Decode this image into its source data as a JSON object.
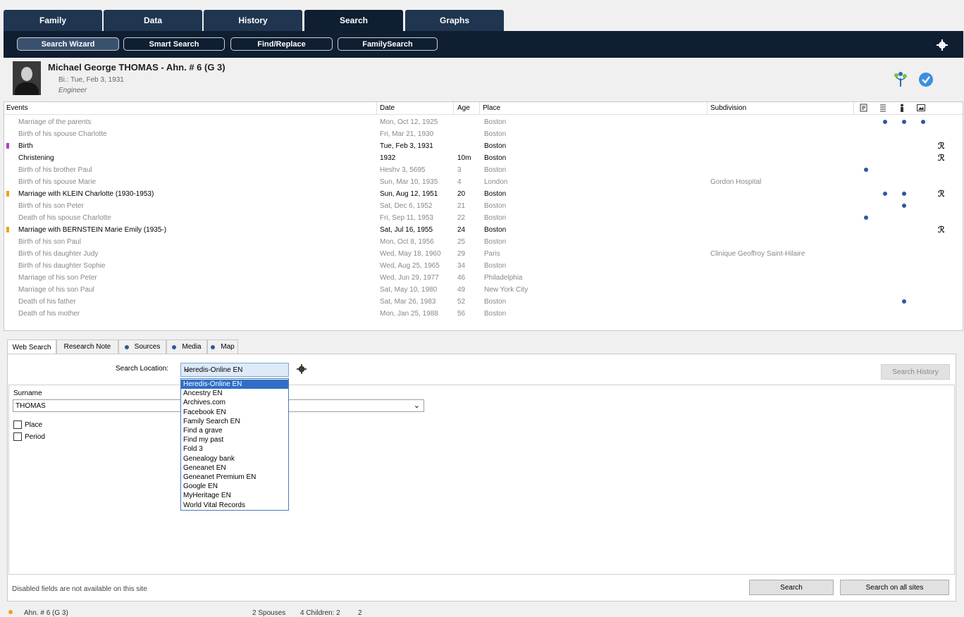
{
  "main_tabs": [
    "Family",
    "Data",
    "History",
    "Search",
    "Graphs"
  ],
  "active_main_tab": "Search",
  "sub_buttons": [
    "Search Wizard",
    "Smart Search",
    "Find/Replace",
    "FamilySearch"
  ],
  "active_sub_button": "Search Wizard",
  "person": {
    "name": "Michael George THOMAS - Ahn. # 6 (G 3)",
    "birth": "Bi.: Tue, Feb 3, 1931",
    "occupation": "Engineer"
  },
  "events_table": {
    "headers": {
      "event": "Events",
      "date": "Date",
      "age": "Age",
      "place": "Place",
      "subdivision": "Subdivision"
    },
    "rows": [
      {
        "event": "Marriage of the parents",
        "date": "Mon, Oct 12, 1925",
        "age": "",
        "place": "Boston",
        "subdivision": "",
        "style": "grey",
        "dots": [
          1,
          2,
          3
        ]
      },
      {
        "event": "Birth of his spouse Charlotte",
        "date": "Fri, Mar 21, 1930",
        "age": "",
        "place": "Boston",
        "subdivision": "",
        "style": "grey",
        "dots": []
      },
      {
        "event": "Birth",
        "date": "Tue, Feb 3, 1931",
        "age": "",
        "place": "Boston",
        "subdivision": "",
        "style": "main",
        "marker": "#b040c0",
        "dots": [],
        "fx": "R̷"
      },
      {
        "event": "Christening",
        "date": "1932",
        "age": "10m",
        "place": "Boston",
        "subdivision": "",
        "style": "main",
        "dots": [],
        "fx": "R"
      },
      {
        "event": "Birth of his brother Paul",
        "date": "Heshv 3, 5695",
        "age": "3",
        "place": "Boston",
        "subdivision": "",
        "style": "grey",
        "dots": [
          0
        ]
      },
      {
        "event": "Birth of his spouse Marie",
        "date": "Sun, Mar 10, 1935",
        "age": "4",
        "place": "London",
        "subdivision": "Gordon Hospital",
        "style": "grey",
        "dots": []
      },
      {
        "event": "Marriage with KLEIN Charlotte (1930-1953)",
        "date": "Sun, Aug 12, 1951",
        "age": "20",
        "place": "Boston",
        "subdivision": "",
        "style": "main",
        "marker": "#f0a020",
        "dots": [
          1,
          2
        ],
        "fx": "R̷"
      },
      {
        "event": "Birth of his son Peter",
        "date": "Sat, Dec 6, 1952",
        "age": "21",
        "place": "Boston",
        "subdivision": "",
        "style": "grey",
        "dots": [
          2
        ]
      },
      {
        "event": "Death of his spouse Charlotte",
        "date": "Fri, Sep 11, 1953",
        "age": "22",
        "place": "Boston",
        "subdivision": "",
        "style": "grey",
        "dots": [
          0
        ]
      },
      {
        "event": "Marriage with BERNSTEIN Marie Emily (1935-)",
        "date": "Sat, Jul 16, 1955",
        "age": "24",
        "place": "Boston",
        "subdivision": "",
        "style": "main",
        "marker": "#f0a020",
        "dots": [],
        "fx": "R̷"
      },
      {
        "event": "Birth of his son Paul",
        "date": "Mon, Oct 8, 1956",
        "age": "25",
        "place": "Boston",
        "subdivision": "",
        "style": "grey",
        "dots": []
      },
      {
        "event": "Birth of his daughter Judy",
        "date": "Wed, May 18, 1960",
        "age": "29",
        "place": "Paris",
        "subdivision": "Clinique Geoffroy Saint-Hilaire",
        "style": "grey",
        "dots": []
      },
      {
        "event": "Birth of his daughter Sophie",
        "date": "Wed, Aug 25, 1965",
        "age": "34",
        "place": "Boston",
        "subdivision": "",
        "style": "grey",
        "dots": []
      },
      {
        "event": "Marriage of his son Peter",
        "date": "Wed, Jun 29, 1977",
        "age": "46",
        "place": "Philadelphia",
        "subdivision": "",
        "style": "grey",
        "dots": []
      },
      {
        "event": "Marriage of his son Paul",
        "date": "Sat, May 10, 1980",
        "age": "49",
        "place": "New York City",
        "subdivision": "",
        "style": "grey",
        "dots": []
      },
      {
        "event": "Death of his father",
        "date": "Sat, Mar 26, 1983",
        "age": "52",
        "place": "Boston",
        "subdivision": "",
        "style": "grey",
        "dots": [
          2
        ]
      },
      {
        "event": "Death of his mother",
        "date": "Mon, Jan 25, 1988",
        "age": "56",
        "place": "Boston",
        "subdivision": "",
        "style": "grey",
        "dots": []
      }
    ]
  },
  "lower_tabs": [
    {
      "label": "Web Search",
      "dot": false
    },
    {
      "label": "Research Note",
      "dot": false
    },
    {
      "label": "Sources",
      "dot": true
    },
    {
      "label": "Media",
      "dot": true
    },
    {
      "label": "Map",
      "dot": true
    }
  ],
  "web_search": {
    "location_label": "Search Location:",
    "location_value": "Heredis-Online EN",
    "history_button": "Search History",
    "surname_label": "Surname",
    "surname_value": "THOMAS",
    "place_label": "Place",
    "period_label": "Period",
    "dropdown_options": [
      "Heredis-Online EN",
      "Ancestry EN",
      "Archives.com",
      "Facebook EN",
      "Family Search EN",
      "Find a grave",
      "Find my past",
      "Fold 3",
      "Genealogy bank",
      "Geneanet EN",
      "Geneanet Premium EN",
      "Google EN",
      "MyHeritage EN",
      "World Vital Records"
    ],
    "disabled_note": "Disabled fields are not available on this site",
    "search_button": "Search",
    "search_all_button": "Search on all sites"
  },
  "status": {
    "ahn": "Ahn. # 6 (G 3)",
    "spouses": "2 Spouses",
    "children": "4 Children: 2",
    "daughters": "2"
  },
  "colors": {
    "nav_dark": "#0f1e31",
    "nav": "#1f3550",
    "accent_blue": "#2f6fc6",
    "dot_blue": "#2b5a9a"
  }
}
